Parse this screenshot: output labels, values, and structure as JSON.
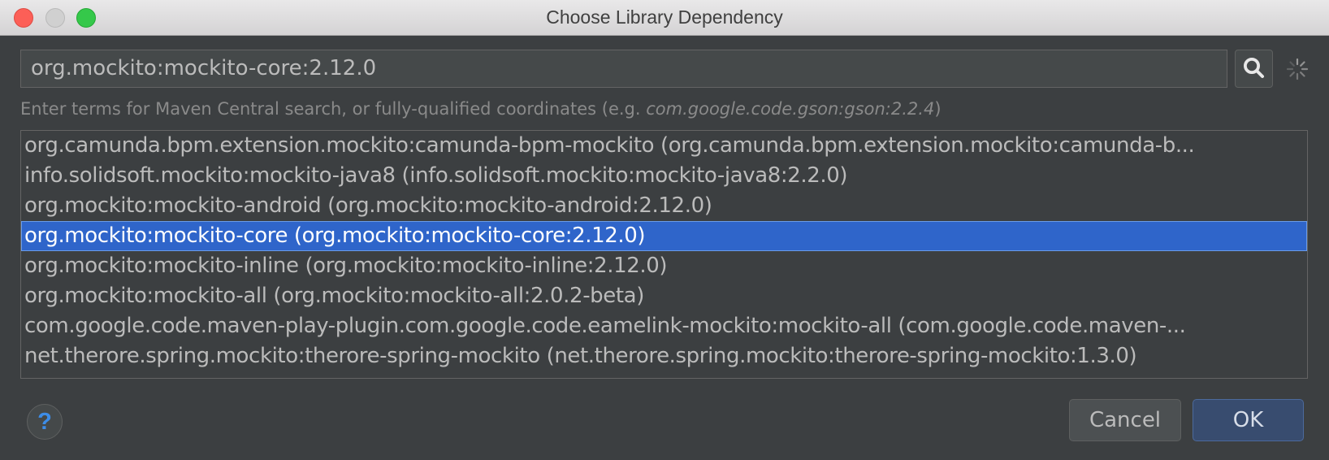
{
  "window": {
    "title": "Choose Library Dependency"
  },
  "search": {
    "value": "org.mockito:mockito-core:2.12.0",
    "button_icon": "search-icon",
    "status_icon": "loading-spinner-icon"
  },
  "hint": {
    "prefix": "Enter terms for Maven Central search, or fully-qualified coordinates (e.g. ",
    "example": "com.google.code.gson:gson:2.2.4",
    "suffix": ")"
  },
  "results": {
    "selected_index": 3,
    "items": [
      "org.camunda.bpm.extension.mockito:camunda-bpm-mockito (org.camunda.bpm.extension.mockito:camunda-b...",
      "info.solidsoft.mockito:mockito-java8 (info.solidsoft.mockito:mockito-java8:2.2.0)",
      "org.mockito:mockito-android (org.mockito:mockito-android:2.12.0)",
      "org.mockito:mockito-core (org.mockito:mockito-core:2.12.0)",
      "org.mockito:mockito-inline (org.mockito:mockito-inline:2.12.0)",
      "org.mockito:mockito-all (org.mockito:mockito-all:2.0.2-beta)",
      "com.google.code.maven-play-plugin.com.google.code.eamelink-mockito:mockito-all (com.google.code.maven-...",
      "net.therore.spring.mockito:therore-spring-mockito (net.therore.spring.mockito:therore-spring-mockito:1.3.0)"
    ]
  },
  "footer": {
    "help_label": "?",
    "cancel_label": "Cancel",
    "ok_label": "OK"
  },
  "colors": {
    "background": "#3c3f41",
    "selection": "#2f65ca",
    "text": "#bbbbbb",
    "help_accent": "#3d8de8"
  }
}
